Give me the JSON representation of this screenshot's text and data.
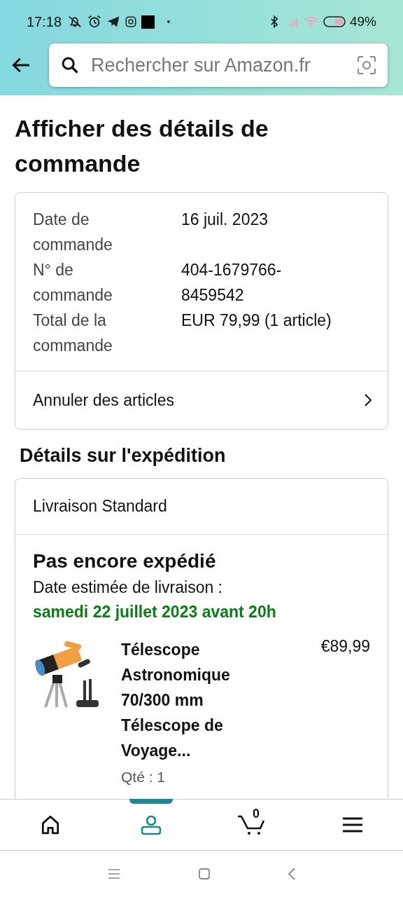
{
  "status_bar": {
    "time": "17:18",
    "battery": "49%"
  },
  "search": {
    "placeholder": "Rechercher sur Amazon.fr"
  },
  "title": "Afficher des détails de commande",
  "order_summary": {
    "rows": [
      {
        "label": "Date de commande",
        "value": "16 juil. 2023"
      },
      {
        "label": "N° de commande",
        "value": "404-1679766-8459542"
      },
      {
        "label": "Total de la commande",
        "value": "EUR 79,99 (1 article)"
      }
    ],
    "action": "Annuler des articles"
  },
  "shipment": {
    "heading": "Détails sur l'expédition",
    "method": "Livraison Standard",
    "status": "Pas encore expédié",
    "estimate_label": "Date estimée de livraison :",
    "estimate_date": "samedi 22 juillet 2023 avant 20h",
    "items": [
      {
        "title": "Télescope Astronomique 70/300 mm Télescope de Voyage...",
        "price": "€89,99",
        "quantity": "Qté : 1"
      }
    ]
  },
  "bottom_nav": [
    {
      "kind": "home",
      "selected": false
    },
    {
      "kind": "account",
      "selected": true
    },
    {
      "kind": "cart",
      "selected": false,
      "count": "0"
    },
    {
      "kind": "menu",
      "selected": false
    }
  ]
}
